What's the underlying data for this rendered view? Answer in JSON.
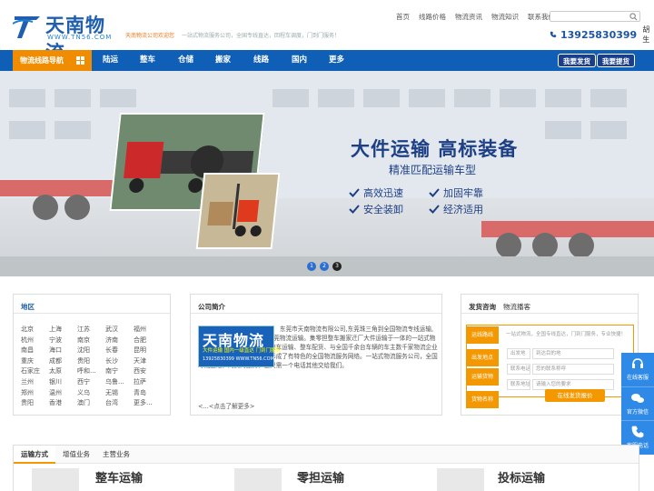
{
  "header": {
    "brand": "天南物流",
    "domain": "WWW.TN56.COM",
    "welcome": "天南物流公司欢迎您",
    "tagline": "一站式物流服务公司，全国专线直达，回程车调度，门到门服务！",
    "topnav": [
      "首页",
      "线路价格",
      "物流资讯",
      "物流知识",
      "联系我们"
    ],
    "phone": "13925830399",
    "contact_name": "胡生",
    "colors": {
      "brand": "#1f5fae",
      "accent": "#f08c00",
      "nav": "#0f5fb6"
    }
  },
  "nav": {
    "guide": "物流线路导航",
    "items": [
      "陆运",
      "整车",
      "仓储",
      "搬家",
      "线路",
      "国内",
      "更多"
    ],
    "buttons": [
      "我要发货",
      "我要提货"
    ]
  },
  "banner": {
    "title": "大件运输  高标装备",
    "subtitle": "精准匹配运输车型",
    "features": [
      "高效迅速",
      "加固牢靠",
      "安全装卸",
      "经济适用"
    ],
    "dots": [
      "1",
      "2",
      "3"
    ],
    "active_dot": 2
  },
  "area": {
    "title": "地区",
    "cities": [
      "北京",
      "上海",
      "江苏",
      "武汉",
      "福州",
      "杭州",
      "宁波",
      "南京",
      "济南",
      "合肥",
      "南昌",
      "海口",
      "沈阳",
      "长春",
      "昆明",
      "重庆",
      "成都",
      "贵阳",
      "长沙",
      "天津",
      "石家庄",
      "太原",
      "呼和...",
      "南宁",
      "西安",
      "兰州",
      "银川",
      "西宁",
      "乌鲁...",
      "拉萨",
      "郑州",
      "温州",
      "义乌",
      "无锡",
      "青岛",
      "贵阳",
      "香港",
      "澳门",
      "台湾",
      "更多..."
    ]
  },
  "intro": {
    "title": "公司简介",
    "logo_text": "天南物流",
    "logo_sub": "大件运输 国内一级直达 门到门服务",
    "logo_sub2": "13925830399 WWW.TN56.COM",
    "text": "东莞市天南物流有限公司,东莞珠三角到全国物流专线运输,回程车调度,东莞货运公司,东莞物流运输。集零担整车搬家迁厂大件运输于一体的一站式物流服务公司，珠三角到全国整车运输、整车配货、与全国千余台车辆的车主数千家物流企业建立了合作伙伴关系，初步形成了有特色的全国物流服务网络。一站式物流服务公司，全国专线直达，门到门服务，您只需一个电话其他交给我们。",
    "more": "<...<点击了解更多>"
  },
  "consult": {
    "tabs": [
      "发货咨询",
      "物流播客"
    ],
    "hint": "一站式物流，全国专线直达，门到门服务，专业快捷！",
    "rows": [
      "运线路线",
      "出发地点",
      "运输货物",
      "货物名称"
    ],
    "fields": [
      {
        "label": "出发地",
        "placeholder": "到达目的地"
      },
      {
        "label": "联系电话",
        "placeholder": "您的联系称呼"
      },
      {
        "label": "联系地址",
        "placeholder": "请输入您的要求"
      }
    ],
    "submit": "在线发货报价"
  },
  "float": {
    "items": [
      "在线客服",
      "官方微信",
      "客服电话"
    ]
  },
  "bottom": {
    "tabs": [
      "运输方式",
      "增值业务",
      "主营业务"
    ],
    "services": [
      "整车运输",
      "零担运输",
      "投标运输"
    ]
  }
}
